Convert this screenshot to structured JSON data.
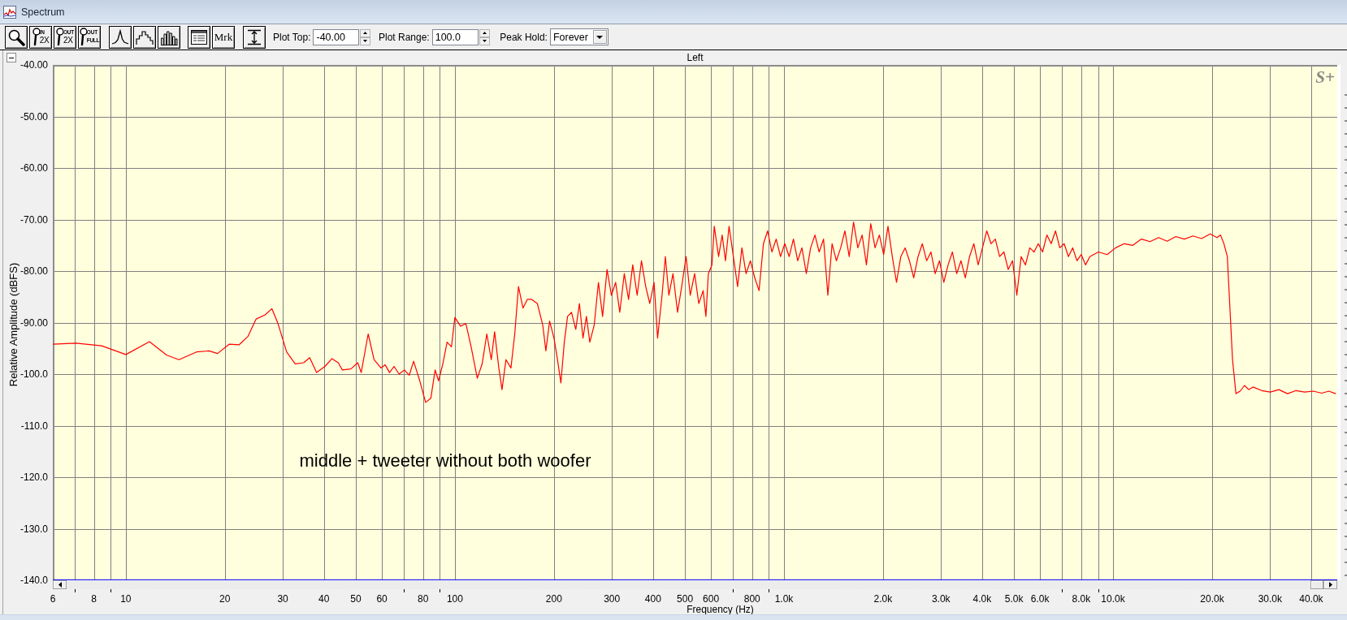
{
  "window": {
    "title": "Spectrum"
  },
  "toolbar": {
    "button_groups": [
      [
        {
          "kind": "zoom"
        },
        {
          "kind": "zoomlabel",
          "top": "IN",
          "bottom": "2X"
        },
        {
          "kind": "zoomlabel",
          "top": "OUT",
          "bottom": "2X"
        },
        {
          "kind": "zoomlabel",
          "top": "OUT",
          "bottom": "FULL"
        }
      ],
      [
        {
          "kind": "line"
        },
        {
          "kind": "steps"
        },
        {
          "kind": "bars"
        }
      ],
      [
        {
          "kind": "table"
        },
        {
          "kind": "text",
          "label": "Mrk"
        }
      ],
      [
        {
          "kind": "range"
        }
      ]
    ],
    "fields": [
      {
        "kind": "spin",
        "label": "Plot Top:",
        "value": "-40.00"
      },
      {
        "kind": "spin",
        "label": "Plot Range:",
        "value": "100.0"
      },
      {
        "kind": "dropdown",
        "label": "Peak Hold:",
        "value": "Forever"
      }
    ]
  },
  "spectrum_panel": {
    "logo": "S+",
    "chart_data": {
      "type": "line",
      "title": "Left",
      "xlabel": "Frequency (Hz)",
      "ylabel": "Relative Amplitude (dBFS)",
      "log": "x",
      "grid": true,
      "x": [
        6,
        7.06,
        8.45,
        10,
        11.8,
        13.3,
        14.5,
        16.4,
        17.9,
        19.0,
        20.6,
        22.1,
        23.5,
        24.9,
        26.5,
        27.8,
        29.0,
        30.8,
        32.7,
        34.7,
        36.2,
        38.0,
        40.3,
        42.3,
        44.2,
        45.5,
        48.3,
        50.7,
        51.9,
        54.5,
        56.8,
        59.6,
        61.4,
        63.3,
        65.3,
        67.7,
        70.2,
        72.7,
        74.9,
        78.2,
        81.5,
        84.5,
        87.1,
        89.2,
        91.9,
        94.7,
        97.6,
        100,
        104,
        108,
        112,
        117,
        121,
        125,
        129,
        132,
        136,
        139,
        143,
        148,
        152,
        156,
        161,
        166,
        171,
        178,
        185,
        189,
        194,
        200,
        205,
        210,
        215,
        220,
        226,
        233,
        239,
        245,
        251,
        257,
        265,
        273,
        281,
        290,
        299,
        308,
        317,
        327,
        337,
        347,
        358,
        369,
        380,
        391,
        403,
        413,
        426,
        436,
        447,
        460,
        475,
        489,
        504,
        519,
        535,
        551,
        568,
        579,
        589,
        604,
        614,
        633,
        649,
        664,
        681,
        702,
        723,
        745,
        767,
        791,
        815,
        840,
        866,
        892,
        919,
        947,
        976,
        1006,
        1037,
        1068,
        1101,
        1134,
        1169,
        1205,
        1242,
        1279,
        1319,
        1359,
        1400,
        1443,
        1487,
        1532,
        1579,
        1627,
        1677,
        1728,
        1781,
        1835,
        1891,
        1949,
        2009,
        2070,
        2133,
        2198,
        2265,
        2334,
        2406,
        2479,
        2555,
        2633,
        2713,
        2796,
        2881,
        2969,
        3059,
        3153,
        3249,
        3348,
        3451,
        3556,
        3664,
        3776,
        3891,
        4010,
        4133,
        4259,
        4388,
        4522,
        4660,
        4803,
        4949,
        5100,
        5256,
        5416,
        5581,
        5752,
        5927,
        6108,
        6295,
        6486,
        6684,
        6888,
        7099,
        7315,
        7538,
        7768,
        8005,
        8249,
        8501,
        9028,
        9588,
        10180,
        10810,
        11480,
        12200,
        12950,
        13750,
        14600,
        15510,
        16470,
        17490,
        18580,
        19730,
        20700,
        21210,
        21720,
        22250,
        22650,
        23070,
        23630,
        24340,
        25080,
        25850,
        26640,
        28290,
        30050,
        31910,
        33880,
        35980,
        38210,
        40590,
        43100,
        45230,
        47500
      ],
      "series": [
        {
          "color": "#ff0000",
          "values": [
            -94.2,
            -94.0,
            -94.5,
            -96.2,
            -93.7,
            -96.3,
            -97.2,
            -95.7,
            -95.5,
            -96.0,
            -94.2,
            -94.3,
            -92.7,
            -89.3,
            -88.5,
            -87.3,
            -90.2,
            -95.7,
            -98.0,
            -97.8,
            -96.8,
            -99.7,
            -98.5,
            -97.0,
            -97.8,
            -99.2,
            -99.0,
            -97.8,
            -99.7,
            -92.2,
            -97.2,
            -98.8,
            -98.2,
            -99.7,
            -98.5,
            -100.0,
            -99.2,
            -100.2,
            -97.5,
            -101.3,
            -105.5,
            -104.7,
            -99.2,
            -101.3,
            -98.0,
            -93.8,
            -94.7,
            -89.0,
            -90.7,
            -90.2,
            -94.7,
            -100.8,
            -98.0,
            -92.2,
            -97.2,
            -91.8,
            -98.8,
            -103.0,
            -97.2,
            -98.8,
            -92.2,
            -83.0,
            -87.2,
            -85.5,
            -85.5,
            -86.3,
            -90.5,
            -95.5,
            -89.7,
            -93.0,
            -97.2,
            -101.7,
            -93.8,
            -88.8,
            -88.0,
            -91.3,
            -86.3,
            -93.0,
            -88.8,
            -93.8,
            -90.5,
            -82.2,
            -88.8,
            -79.7,
            -84.7,
            -82.2,
            -88.0,
            -80.5,
            -85.5,
            -78.8,
            -84.7,
            -78.0,
            -83.0,
            -86.3,
            -82.2,
            -93.0,
            -84.7,
            -77.2,
            -84.7,
            -80.5,
            -88.0,
            -83.0,
            -77.2,
            -84.7,
            -80.5,
            -86.3,
            -83.8,
            -88.8,
            -80.5,
            -78.8,
            -71.3,
            -77.2,
            -73.0,
            -78.0,
            -71.3,
            -77.2,
            -83.0,
            -75.5,
            -80.5,
            -78.0,
            -81.3,
            -83.8,
            -74.7,
            -72.2,
            -76.3,
            -73.8,
            -77.2,
            -74.7,
            -77.2,
            -73.8,
            -78.0,
            -75.5,
            -80.5,
            -75.5,
            -73.0,
            -76.3,
            -73.8,
            -84.7,
            -74.7,
            -78.0,
            -75.5,
            -72.2,
            -77.2,
            -70.5,
            -75.5,
            -73.0,
            -78.8,
            -70.8,
            -75.5,
            -73.0,
            -76.8,
            -71.3,
            -77.2,
            -82.2,
            -77.2,
            -75.5,
            -78.0,
            -81.3,
            -77.2,
            -74.7,
            -78.0,
            -76.3,
            -80.5,
            -78.0,
            -82.2,
            -78.8,
            -76.3,
            -80.5,
            -78.0,
            -81.3,
            -77.2,
            -74.7,
            -78.8,
            -75.5,
            -72.2,
            -74.7,
            -73.8,
            -77.2,
            -76.3,
            -79.7,
            -78.0,
            -84.7,
            -77.2,
            -78.8,
            -75.5,
            -76.3,
            -74.7,
            -76.3,
            -73.0,
            -74.7,
            -72.2,
            -75.5,
            -74.7,
            -77.2,
            -75.5,
            -78.0,
            -76.8,
            -78.8,
            -77.2,
            -76.3,
            -76.8,
            -75.5,
            -74.7,
            -75.0,
            -73.8,
            -74.3,
            -73.5,
            -74.2,
            -73.3,
            -73.8,
            -73.2,
            -73.7,
            -72.8,
            -73.5,
            -73.0,
            -74.7,
            -77.2,
            -87.2,
            -97.2,
            -103.8,
            -103.3,
            -102.2,
            -103.0,
            -102.5,
            -103.2,
            -103.5,
            -103.0,
            -103.8,
            -103.2,
            -103.5,
            -103.3,
            -103.7,
            -103.3,
            -103.8
          ]
        }
      ],
      "xlim": [
        6,
        48000
      ],
      "ylim": [
        -140,
        -40
      ],
      "xticks": [
        {
          "value": 6,
          "label": "6"
        },
        {
          "value": 8,
          "label": "8"
        },
        {
          "value": 10,
          "label": "10"
        },
        {
          "value": 20,
          "label": "20"
        },
        {
          "value": 30,
          "label": "30"
        },
        {
          "value": 40,
          "label": "40"
        },
        {
          "value": 50,
          "label": "50"
        },
        {
          "value": 60,
          "label": "60"
        },
        {
          "value": 80,
          "label": "80"
        },
        {
          "value": 100,
          "label": "100"
        },
        {
          "value": 200,
          "label": "200"
        },
        {
          "value": 300,
          "label": "300"
        },
        {
          "value": 400,
          "label": "400"
        },
        {
          "value": 500,
          "label": "500"
        },
        {
          "value": 600,
          "label": "600"
        },
        {
          "value": 800,
          "label": "800"
        },
        {
          "value": 1000,
          "label": "1.0k"
        },
        {
          "value": 2000,
          "label": "2.0k"
        },
        {
          "value": 3000,
          "label": "3.0k"
        },
        {
          "value": 4000,
          "label": "4.0k"
        },
        {
          "value": 5000,
          "label": "5.0k"
        },
        {
          "value": 6000,
          "label": "6.0k"
        },
        {
          "value": 8000,
          "label": "8.0k"
        },
        {
          "value": 10000,
          "label": "10.0k"
        },
        {
          "value": 20000,
          "label": "20.0k"
        },
        {
          "value": 30000,
          "label": "30.0k"
        },
        {
          "value": 40000,
          "label": "40.0k"
        }
      ],
      "yticks": [
        {
          "value": -40,
          "label": "-40.00"
        },
        {
          "value": -50,
          "label": "-50.00"
        },
        {
          "value": -60,
          "label": "-60.00"
        },
        {
          "value": -70,
          "label": "-70.00"
        },
        {
          "value": -80,
          "label": "-80.00"
        },
        {
          "value": -90,
          "label": "-90.00"
        },
        {
          "value": -100,
          "label": "-100.0"
        },
        {
          "value": -110,
          "label": "-110.0"
        },
        {
          "value": -120,
          "label": "-120.0"
        },
        {
          "value": -130,
          "label": "-130.0"
        },
        {
          "value": -140,
          "label": "-140.0"
        }
      ],
      "annotations": [
        "middle + tweeter without both woofer"
      ]
    }
  }
}
